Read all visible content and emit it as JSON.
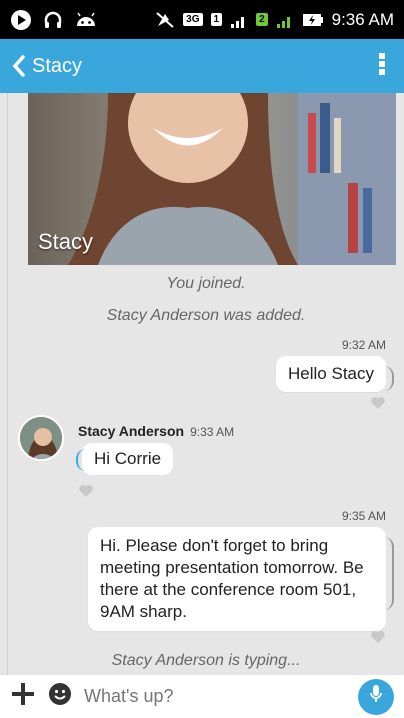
{
  "status_bar": {
    "time": "9:36 AM",
    "badge_3g": "3G",
    "sim1": "1",
    "sim2": "2"
  },
  "app_bar": {
    "title": "Stacy"
  },
  "hero": {
    "caption": "Stacy"
  },
  "messages": {
    "joined": "You joined.",
    "added": "Stacy Anderson was added.",
    "out1_time": "9:32 AM",
    "out1_text": "Hello Stacy",
    "in1_sender": "Stacy Anderson",
    "in1_time": "9:33 AM",
    "in1_text": "Hi Corrie",
    "out2_time": "9:35 AM",
    "out2_text": "Hi. Please don't forget to bring meeting presentation tomorrow. Be there at the conference room 501, 9AM sharp.",
    "typing": "Stacy Anderson is typing..."
  },
  "composer": {
    "placeholder": "What's up?"
  },
  "colors": {
    "accent": "#3aa7dc",
    "background": "#e6e6e6"
  }
}
